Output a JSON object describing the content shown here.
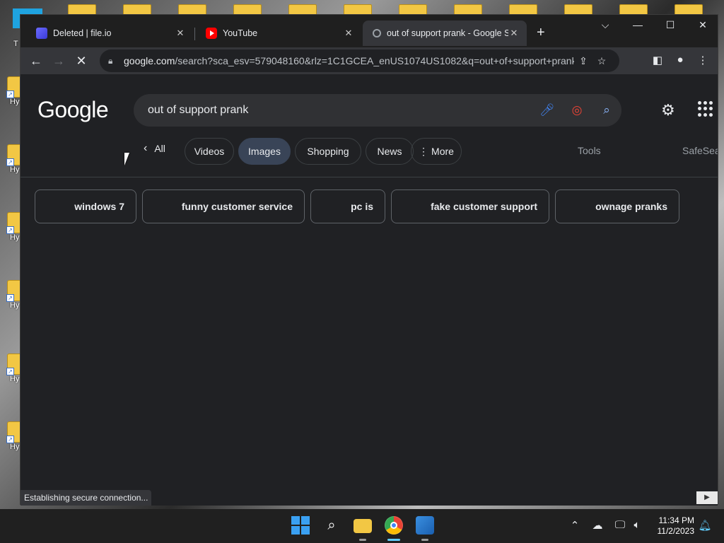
{
  "desktop": {
    "icon_labels": [
      "Hy Sh",
      "Hy Sh",
      "Hy Sh",
      "Hy Sh",
      "Hy Sh",
      "Hy Sh"
    ],
    "letter": "T"
  },
  "browser": {
    "tabs": [
      {
        "title": "Deleted | file.io",
        "icon": "file-io-icon",
        "active": false
      },
      {
        "title": "YouTube",
        "icon": "youtube-icon",
        "active": false
      },
      {
        "title": "out of support prank - Google S",
        "icon": "loading-icon",
        "active": true
      }
    ],
    "url_host": "google.com",
    "url_path": "/search?sca_esv=579048160&rlz=1C1GCEA_enUS1074US1082&q=out+of+support+prank&tb...",
    "status": "Establishing secure connection..."
  },
  "google": {
    "logo": "Google",
    "query": "out of support prank",
    "back_label": "All",
    "filters": [
      "Videos",
      "Images",
      "Shopping",
      "News",
      "More"
    ],
    "selected_filter": "Images",
    "tools": "Tools",
    "safesearch": "SafeSea",
    "refinements": [
      "windows 7",
      "funny customer service",
      "pc is",
      "fake customer support",
      "ownage pranks"
    ]
  },
  "taskbar": {
    "time": "11:34 PM",
    "date": "11/2/2023"
  },
  "colors": {
    "page_bg": "#202124",
    "selected_chip": "#394457",
    "youtube_red": "#ff0000"
  }
}
